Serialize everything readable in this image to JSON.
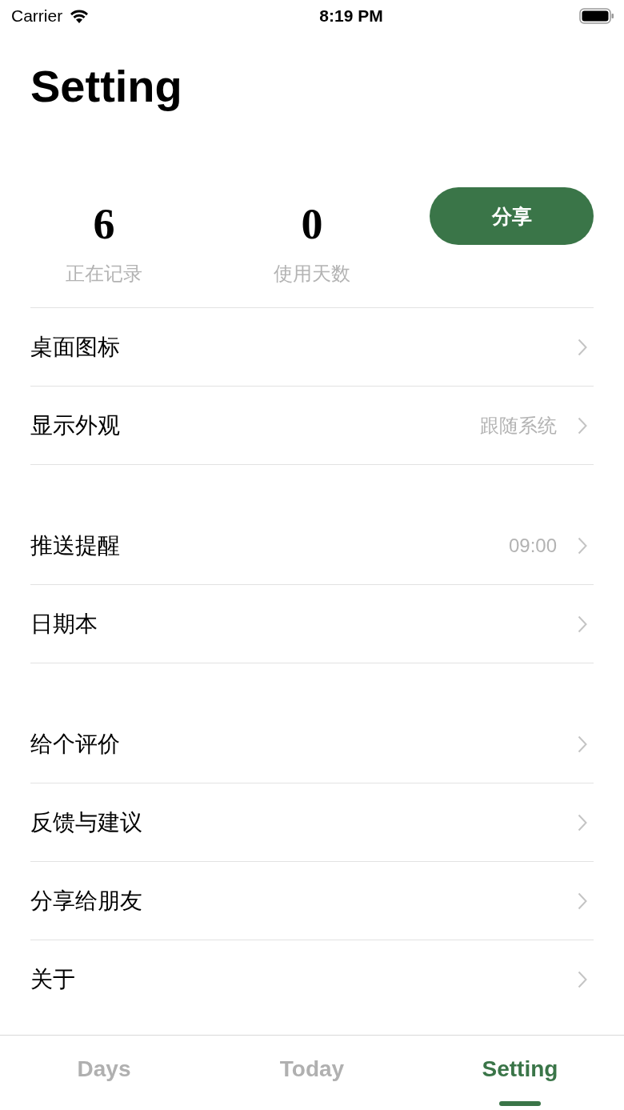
{
  "status_bar": {
    "carrier": "Carrier",
    "time": "8:19 PM"
  },
  "title": "Setting",
  "stats": [
    {
      "value": "6",
      "label": "正在记录"
    },
    {
      "value": "0",
      "label": "使用天数"
    }
  ],
  "share_button": "分享",
  "sections": [
    {
      "items": [
        {
          "label": "桌面图标"
        },
        {
          "label": "显示外观",
          "value": "跟随系统"
        }
      ]
    },
    {
      "items": [
        {
          "label": "推送提醒",
          "value": "09:00"
        },
        {
          "label": "日期本"
        }
      ]
    },
    {
      "items": [
        {
          "label": "给个评价"
        },
        {
          "label": "反馈与建议"
        },
        {
          "label": "分享给朋友"
        },
        {
          "label": "关于"
        }
      ]
    }
  ],
  "tabs": [
    {
      "label": "Days",
      "selected": false
    },
    {
      "label": "Today",
      "selected": false
    },
    {
      "label": "Setting",
      "selected": true
    }
  ]
}
